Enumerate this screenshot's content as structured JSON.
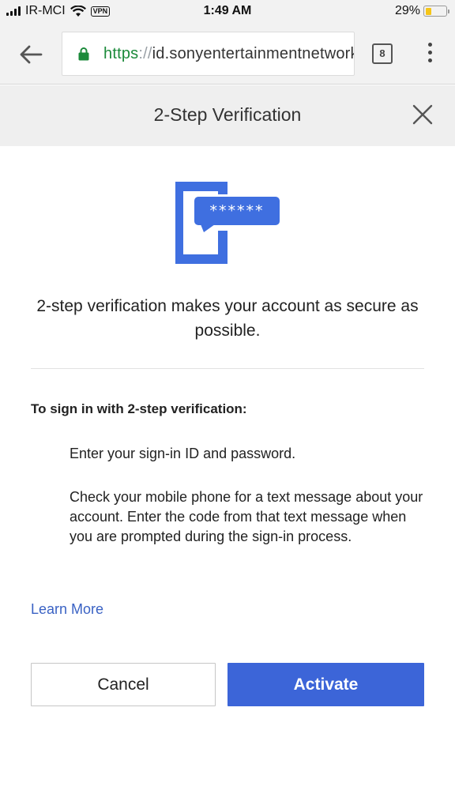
{
  "status_bar": {
    "carrier": "IR-MCI",
    "vpn_label": "VPN",
    "time": "1:49 AM",
    "battery_text": "29%",
    "battery_level": 0.29
  },
  "browser": {
    "url_scheme": "https",
    "url_separator": "://",
    "url_host": "id.sonyentertainmentnetwork.com",
    "tab_count": "8"
  },
  "header": {
    "title": "2-Step Verification"
  },
  "hero": {
    "code_mask": "******"
  },
  "content": {
    "intro": "2-step verification makes your account as secure as possible.",
    "steps_heading": "To sign in with 2-step verification:",
    "steps": [
      "Enter your sign-in ID and password.",
      "Check your mobile phone for a text message about your account. Enter the code from that text message when you are prompted during the sign-in process."
    ],
    "learn_more": "Learn More"
  },
  "actions": {
    "cancel_label": "Cancel",
    "activate_label": "Activate"
  },
  "colors": {
    "accent": "#3c65d8",
    "secure_green": "#1b8a3a",
    "link": "#3a62c4",
    "battery": "#f5c518"
  }
}
